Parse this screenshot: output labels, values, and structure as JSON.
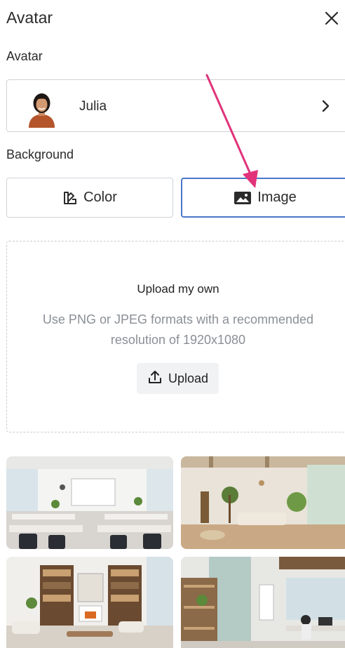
{
  "panel": {
    "title": "Avatar"
  },
  "avatar": {
    "section_label": "Avatar",
    "name": "Julia"
  },
  "background": {
    "section_label": "Background",
    "options": [
      {
        "label": "Color",
        "icon": "palette-icon"
      },
      {
        "label": "Image",
        "icon": "image-icon",
        "selected": true
      }
    ]
  },
  "upload": {
    "title": "Upload my own",
    "description": "Use PNG or JPEG formats with a recommended resolution of 1920x1080",
    "button_label": "Upload"
  },
  "colors": {
    "accent": "#4a78c9",
    "annotation_arrow": "#e0337a",
    "muted_text": "#8a8f96"
  }
}
